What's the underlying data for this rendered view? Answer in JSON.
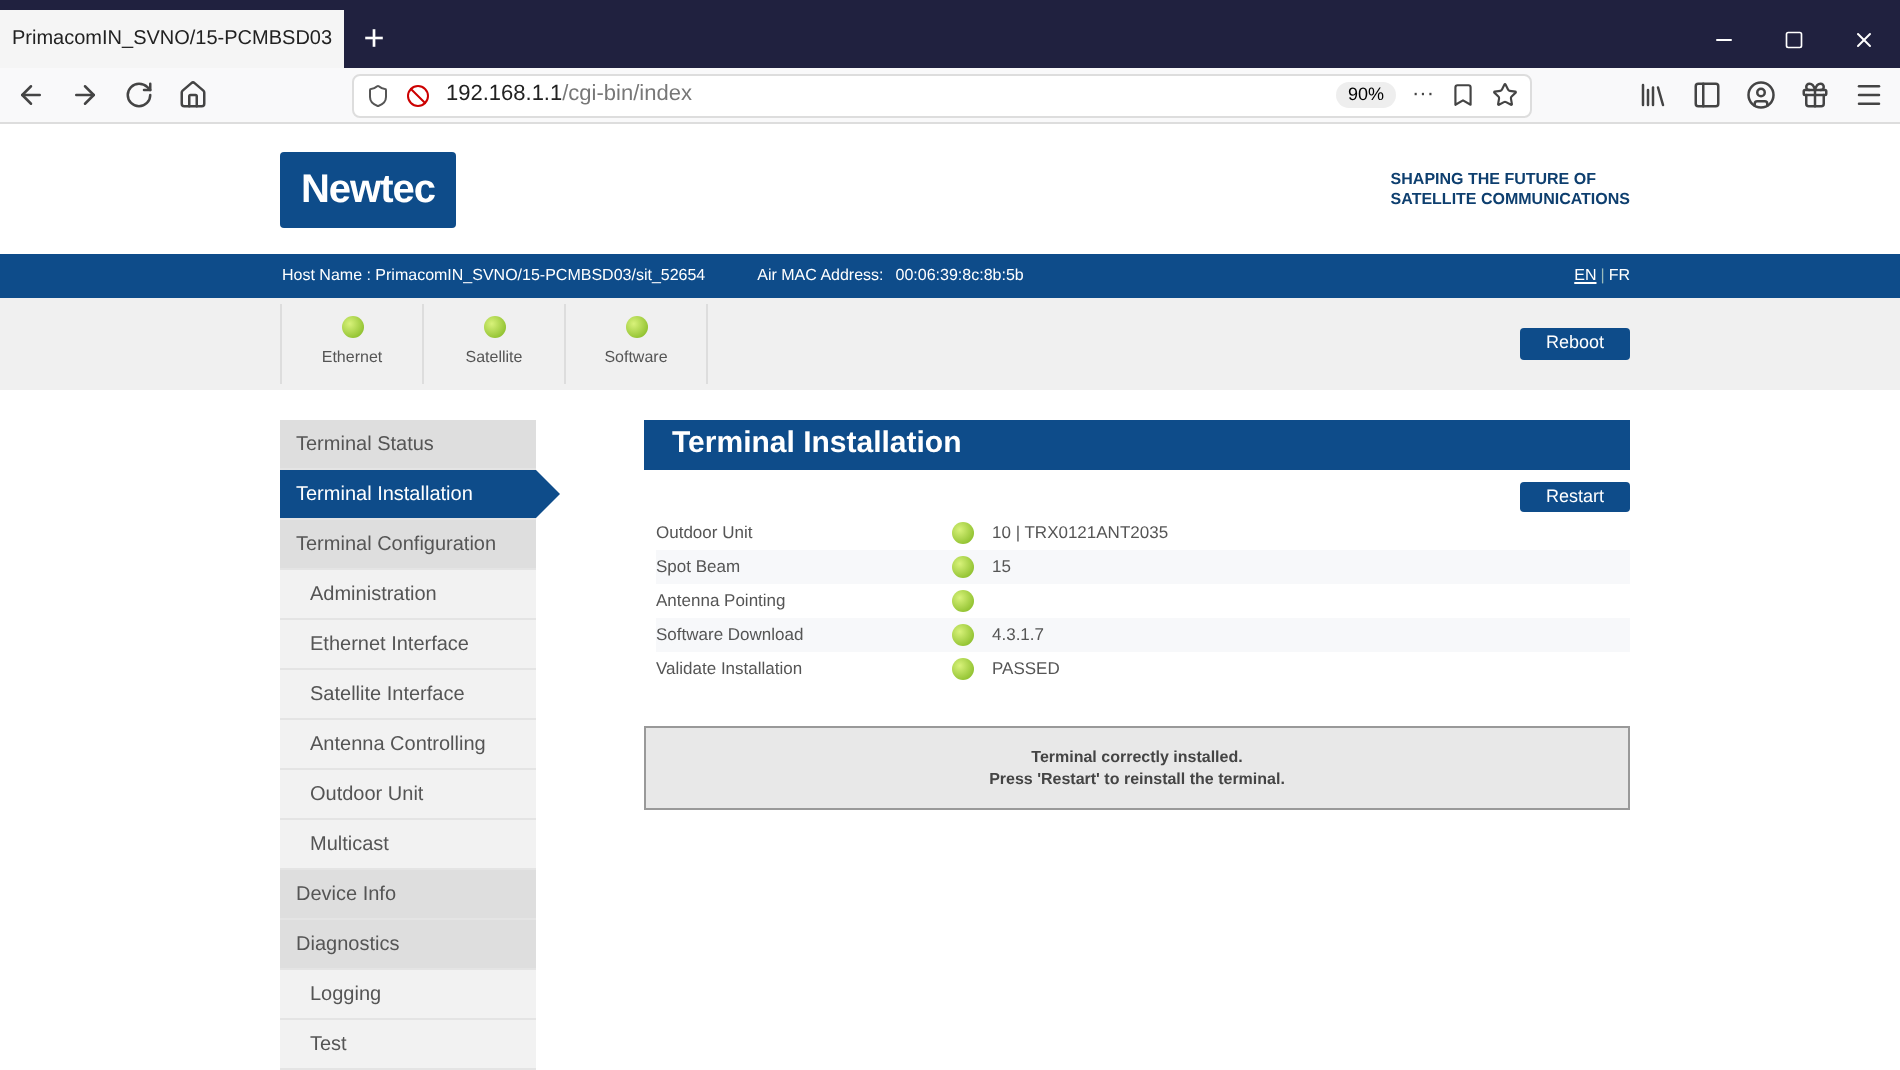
{
  "browser": {
    "tab_title": "PrimacomIN_SVNO/15-PCMBSD03",
    "new_tab": "+",
    "url_host": "192.168.1.1",
    "url_path": "/cgi-bin/index",
    "zoom": "90%",
    "more": "···"
  },
  "header": {
    "logo": "Newtec",
    "tagline_1": "SHAPING THE FUTURE OF",
    "tagline_2": "SATELLITE COMMUNICATIONS"
  },
  "info_bar": {
    "host": "Host Name : PrimacomIN_SVNO/15-PCMBSD03/sit_52654",
    "mac_label": "Air MAC Address:",
    "mac": "00:06:39:8c:8b:5b",
    "languages": [
      {
        "label": "EN",
        "selected": true
      },
      {
        "label": "FR",
        "selected": false
      }
    ],
    "separator": "|"
  },
  "indicators": [
    {
      "label": "Ethernet",
      "ok": true
    },
    {
      "label": "Satellite",
      "ok": true
    },
    {
      "label": "Software",
      "ok": true
    }
  ],
  "reboot": "Reboot",
  "sidebar": [
    {
      "label": "Terminal Status",
      "selected": false
    },
    {
      "label": "Terminal Installation",
      "selected": true
    },
    {
      "label": "Terminal Configuration",
      "selected": false,
      "children": [
        {
          "label": "Administration",
          "selected": false
        },
        {
          "label": "Ethernet Interface",
          "selected": false
        },
        {
          "label": "Satellite Interface",
          "selected": false
        },
        {
          "label": "Antenna Controlling",
          "selected": false
        },
        {
          "label": "Outdoor Unit",
          "selected": false
        },
        {
          "label": "Multicast",
          "selected": false
        }
      ]
    },
    {
      "label": "Device Info",
      "selected": false
    },
    {
      "label": "Diagnostics",
      "selected": false,
      "children": [
        {
          "label": "Logging",
          "selected": false
        },
        {
          "label": "Test",
          "selected": false
        }
      ]
    }
  ],
  "main": {
    "title": "Terminal Installation",
    "restart": "Restart",
    "rows": [
      {
        "label": "Outdoor Unit",
        "ok": true,
        "value": "10 | TRX0121ANT2035"
      },
      {
        "label": "Spot Beam",
        "ok": true,
        "value": "15"
      },
      {
        "label": "Antenna Pointing",
        "ok": true
      },
      {
        "label": "Software Download",
        "ok": true,
        "value": "4.3.1.7"
      },
      {
        "label": "Validate Installation",
        "ok": true,
        "value": "PASSED"
      }
    ],
    "message_1": "Terminal correctly installed.",
    "message_2": "Press 'Restart' to reinstall the terminal."
  }
}
